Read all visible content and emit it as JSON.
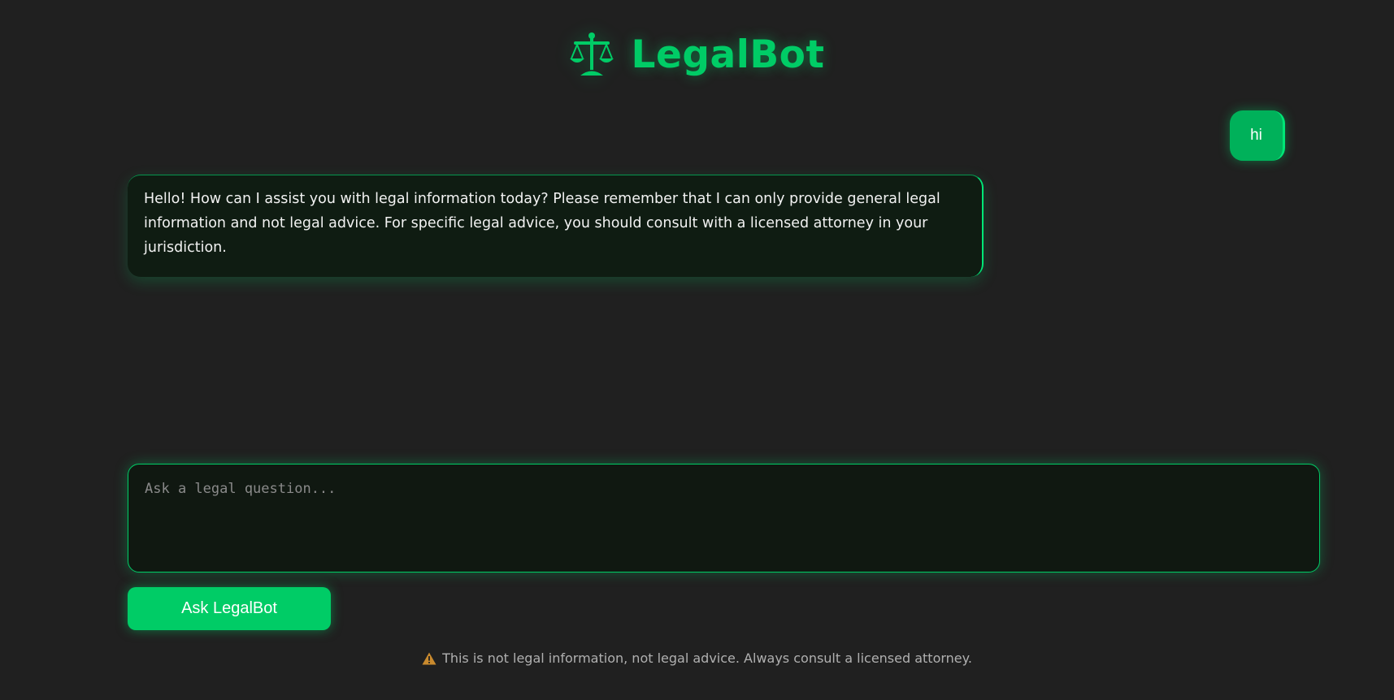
{
  "app": {
    "title": "LegalBot",
    "logo_icon": "scales-of-justice-icon"
  },
  "colors": {
    "background": "#202020",
    "accent": "#00cc66",
    "bot_bubble": "#0f1c12",
    "warning": "#c98a2e"
  },
  "messages": [
    {
      "role": "user",
      "text": "hi"
    },
    {
      "role": "bot",
      "text": "Hello! How can I assist you with legal information today? Please remember that I can only provide general legal information and not legal advice. For specific legal advice, you should consult with a licensed attorney in your jurisdiction."
    }
  ],
  "composer": {
    "placeholder": "Ask a legal question...",
    "value": "",
    "submit_label": "Ask LegalBot"
  },
  "footer": {
    "icon": "warning-icon",
    "disclaimer": "This is not legal information, not legal advice. Always consult a licensed attorney."
  }
}
